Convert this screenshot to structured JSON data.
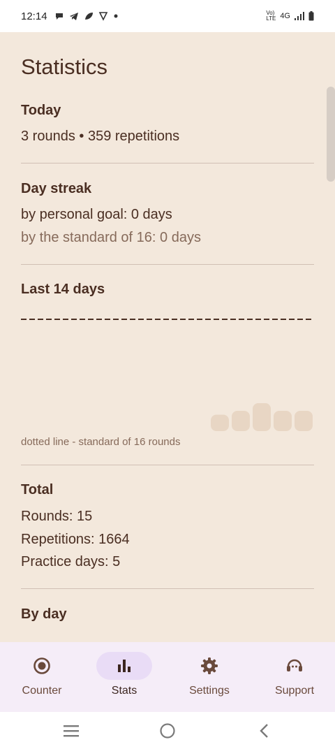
{
  "status_bar": {
    "time": "12:14",
    "network": "4G",
    "volte": "Vo) LTE"
  },
  "page": {
    "title": "Statistics"
  },
  "today": {
    "title": "Today",
    "summary": "3 rounds • 359 repetitions"
  },
  "streak": {
    "title": "Day streak",
    "personal": "by personal goal: 0 days",
    "standard": "by the standard of 16: 0 days"
  },
  "last14": {
    "title": "Last 14 days",
    "caption": "dotted line - standard of 16 rounds",
    "standard_rounds": 16,
    "chart_data": {
      "type": "bar",
      "days": 14,
      "values": [
        0,
        0,
        0,
        0,
        0,
        0,
        0,
        0,
        0,
        1,
        2,
        4,
        2,
        2
      ],
      "ylim": [
        0,
        16
      ],
      "reference_line": 16
    }
  },
  "total": {
    "title": "Total",
    "rounds": "Rounds: 15",
    "repetitions": "Repetitions: 1664",
    "practice_days": "Practice days: 5"
  },
  "by_day": {
    "title": "By day"
  },
  "colors": {
    "background": "#f3e8dc",
    "text": "#4a2e22",
    "muted": "#866a5a",
    "bar": "#e8d6c4",
    "nav_bg": "#f5edf8",
    "nav_active": "#e9dcf6"
  },
  "bottom_nav": [
    {
      "label": "Counter",
      "icon": "target-icon",
      "active": false
    },
    {
      "label": "Stats",
      "icon": "bar-chart-icon",
      "active": true
    },
    {
      "label": "Settings",
      "icon": "gear-icon",
      "active": false
    },
    {
      "label": "Support",
      "icon": "support-icon",
      "active": false
    }
  ]
}
